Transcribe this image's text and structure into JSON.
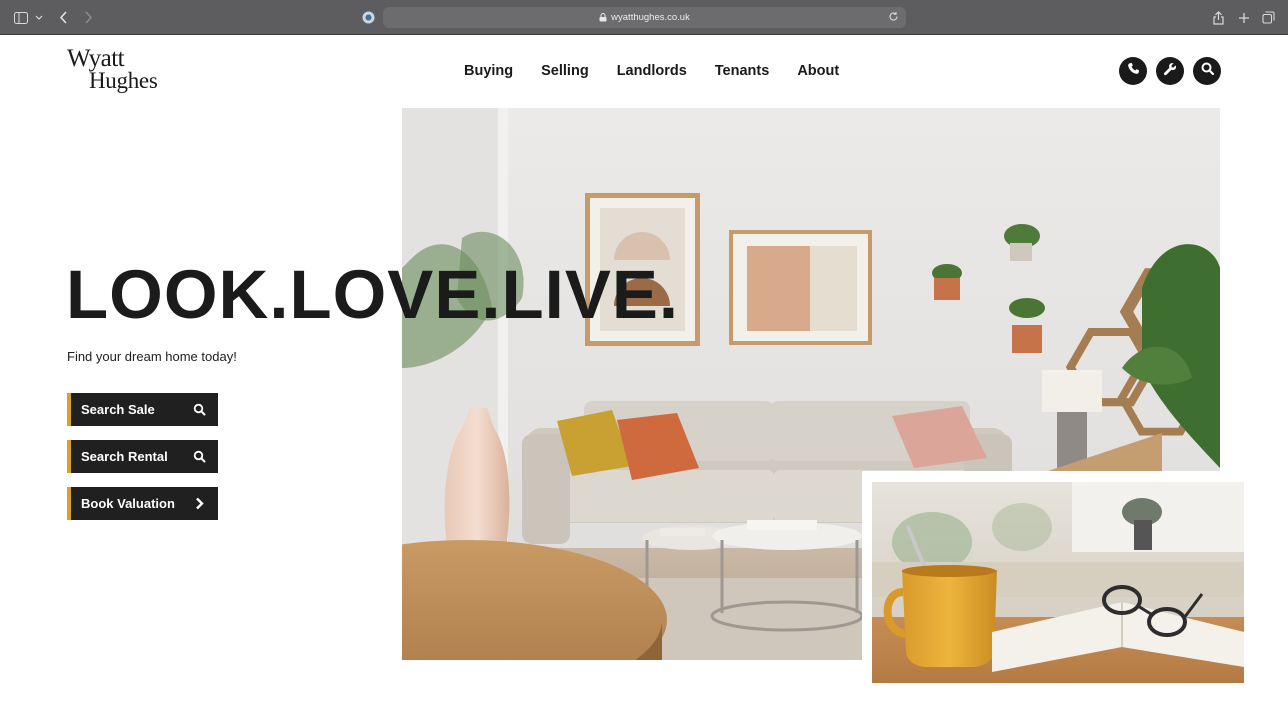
{
  "browser": {
    "url": "wyatthughes.co.uk",
    "icons": [
      "sidebar-icon",
      "chevron-down-icon",
      "back-arrow-icon",
      "forward-arrow-icon",
      "lock-icon",
      "reload-icon",
      "share-icon",
      "plus-icon",
      "tabs-icon"
    ]
  },
  "site": {
    "logo": {
      "line1": "Wyatt",
      "line2": "Hughes"
    },
    "nav": [
      {
        "label": "Buying"
      },
      {
        "label": "Selling"
      },
      {
        "label": "Landlords"
      },
      {
        "label": "Tenants"
      },
      {
        "label": "About"
      }
    ],
    "header_icons": [
      "phone-icon",
      "wrench-icon",
      "search-icon"
    ]
  },
  "hero": {
    "headline": "LOOK.LOVE.LIVE.",
    "subheadline": "Find your dream home today!",
    "buttons": [
      {
        "label": "Search Sale",
        "icon": "search-icon"
      },
      {
        "label": "Search Rental",
        "icon": "search-icon"
      },
      {
        "label": "Book Valuation",
        "icon": "chevron-right-icon"
      }
    ],
    "accent_color": "#d4a52a",
    "button_bg": "#202020"
  }
}
